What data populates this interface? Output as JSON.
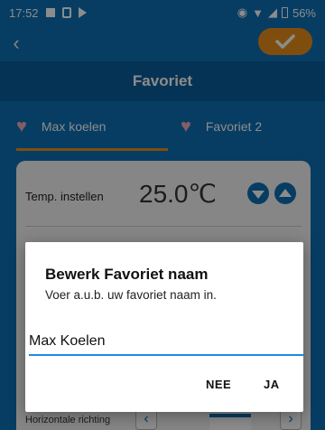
{
  "status_bar": {
    "time": "17:52",
    "battery": "56%"
  },
  "top_bar": {
    "back_icon": "chevron-left-icon",
    "confirm_icon": "checkmark-icon",
    "accent_color": "#e88f1a"
  },
  "title": "Favoriet",
  "tabs": [
    {
      "label": "Max koelen",
      "selected": true
    },
    {
      "label": "Favoriet 2",
      "selected": false
    }
  ],
  "settings": {
    "temp_label": "Temp. instellen",
    "temp_value": "25.0℃",
    "horizontal_label": "Horizontale richting"
  },
  "dialog": {
    "title": "Bewerk Favoriet naam",
    "message": "Voer a.u.b. uw favoriet naam in.",
    "input_value": "Max Koelen",
    "cancel_label": "NEE",
    "ok_label": "JA"
  },
  "colors": {
    "primary": "#0d6fb4",
    "title_bar": "#0a5e9c",
    "input_underline": "#1e88e5"
  }
}
